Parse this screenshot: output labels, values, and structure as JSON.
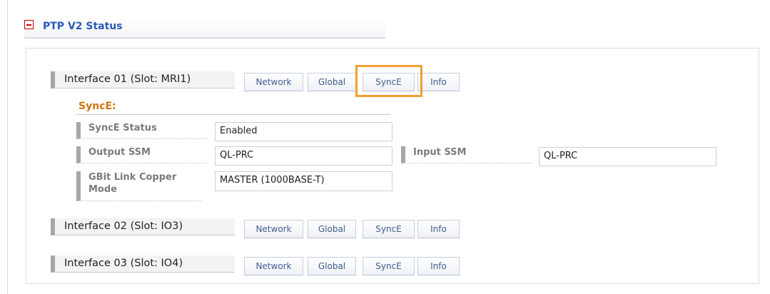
{
  "section": {
    "title": "PTP V2 Status"
  },
  "tabs": [
    "Network",
    "Global",
    "SyncE",
    "Info"
  ],
  "interfaces": [
    {
      "label": "Interface 01 (Slot: MRI1)"
    },
    {
      "label": "Interface 02 (Slot: IO3)"
    },
    {
      "label": "Interface 03 (Slot: IO4)"
    }
  ],
  "synce": {
    "title": "SyncE:",
    "status_label": "SyncE Status",
    "status_value": "Enabled",
    "output_label": "Output SSM",
    "output_value": "QL-PRC",
    "input_label": "Input SSM",
    "input_value": "QL-PRC",
    "gbit_label": "GBit Link Copper Mode",
    "gbit_value": "MASTER (1000BASE-T)"
  },
  "colors": {
    "title_blue": "#2a5ab8",
    "synce_orange": "#d4720f",
    "highlight": "#f0a030",
    "minus_red": "#d00000"
  }
}
